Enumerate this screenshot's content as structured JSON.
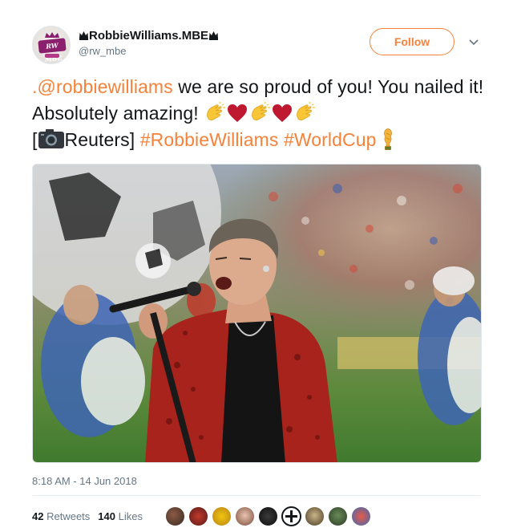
{
  "author": {
    "display_name": "RobbieWilliams.MBE",
    "handle": "@rw_mbe",
    "avatar_text": "RW MBE"
  },
  "follow_label": "Follow",
  "tweet": {
    "mention": ".@robbiewilliams",
    "text1": " we are so proud of you! You nailed it! Absolutely amazing! ",
    "bracket_open": "[",
    "credit": "Reuters] ",
    "hashtag1": "#RobbieWilliams",
    "hashtag2": "#WorldCup",
    "emojis": [
      "clapping-hands",
      "red-heart",
      "clapping-hands",
      "red-heart",
      "clapping-hands",
      "camera",
      "trophy"
    ]
  },
  "timestamp": "8:18 AM - 14 Jun 2018",
  "stats": {
    "retweets_count": "42",
    "retweets_label": "Retweets",
    "likes_count": "140",
    "likes_label": "Likes"
  },
  "colors": {
    "accent": "#f6823a",
    "text": "#14171a",
    "muted": "#657786"
  },
  "liker_avatars": 10
}
